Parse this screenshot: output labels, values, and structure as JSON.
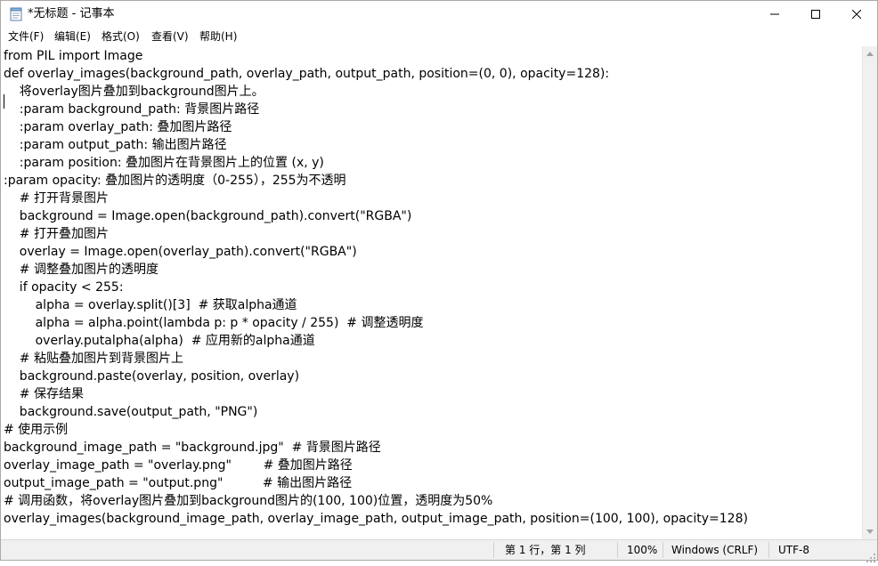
{
  "window": {
    "title": "*无标题 - 记事本"
  },
  "menu": [
    "文件(F)",
    "编辑(E)",
    "格式(O)",
    "查看(V)",
    "帮助(H)"
  ],
  "editor_lines": [
    "from PIL import Image",
    "def overlay_images(background_path, overlay_path, output_path, position=(0, 0), opacity=128):",
    "    将overlay图片叠加到background图片上。",
    "    :param background_path: 背景图片路径",
    "    :param overlay_path: 叠加图片路径",
    "    :param output_path: 输出图片路径",
    "    :param position: 叠加图片在背景图片上的位置 (x, y)",
    ":param opacity: 叠加图片的透明度（0-255），255为不透明",
    "    # 打开背景图片",
    "    background = Image.open(background_path).convert(\"RGBA\")",
    "    # 打开叠加图片",
    "    overlay = Image.open(overlay_path).convert(\"RGBA\")",
    "    # 调整叠加图片的透明度",
    "    if opacity < 255:",
    "        alpha = overlay.split()[3]  # 获取alpha通道",
    "        alpha = alpha.point(lambda p: p * opacity / 255)  # 调整透明度",
    "        overlay.putalpha(alpha)  # 应用新的alpha通道",
    "    # 粘贴叠加图片到背景图片上",
    "    background.paste(overlay, position, overlay)",
    "    # 保存结果",
    "    background.save(output_path, \"PNG\")",
    "# 使用示例",
    "background_image_path = \"background.jpg\"  # 背景图片路径",
    "overlay_image_path = \"overlay.png\"        # 叠加图片路径",
    "output_image_path = \"output.png\"          # 输出图片路径",
    "# 调用函数，将overlay图片叠加到background图片的(100, 100)位置，透明度为50%",
    "overlay_images(background_image_path, overlay_image_path, output_image_path, position=(100, 100), opacity=128)"
  ],
  "status": {
    "position": "第 1 行，第 1 列",
    "zoom": "100%",
    "line_ending": "Windows (CRLF)",
    "encoding": "UTF-8"
  },
  "icons": {
    "app": "notepad-icon",
    "minimize": "minimize-icon",
    "maximize": "maximize-icon",
    "close": "close-icon"
  }
}
